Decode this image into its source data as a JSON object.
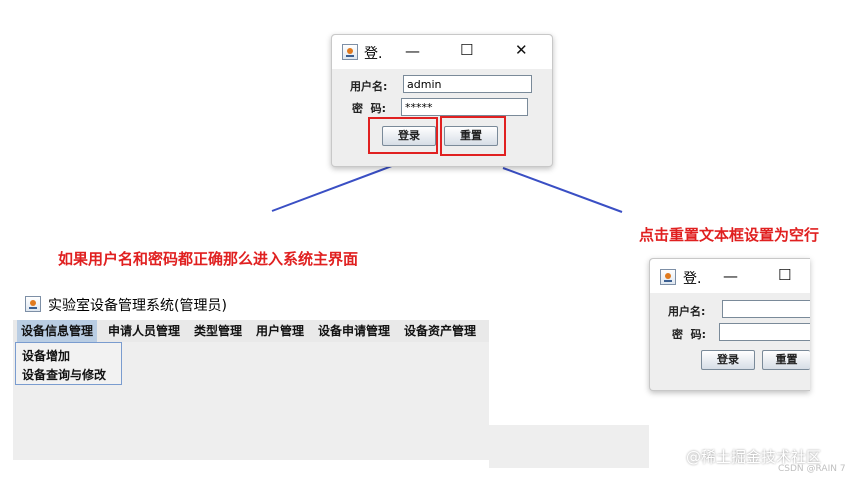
{
  "login_window_top": {
    "title": "登.",
    "minimize": "—",
    "maximize": "☐",
    "close": "✕",
    "username_label": "用户名:",
    "username_value": "admin",
    "password_label": "密  码:",
    "password_value": "*****",
    "login_button": "登录",
    "reset_button": "重置"
  },
  "annotations": {
    "success_note": "如果用户名和密码都正确那么进入系统主界面",
    "reset_note": "点击重置文本框设置为空行"
  },
  "main_window": {
    "title": "实验室设备管理系统(管理员)",
    "menus": [
      {
        "label": "设备信息管理"
      },
      {
        "label": "申请人员管理"
      },
      {
        "label": "类型管理"
      },
      {
        "label": "用户管理"
      },
      {
        "label": "设备申请管理"
      },
      {
        "label": "设备资产管理"
      }
    ],
    "dropdown_items": [
      "设备增加",
      "设备查询与修改"
    ]
  },
  "login_window_reset": {
    "title": "登.",
    "minimize": "—",
    "maximize": "☐",
    "username_label": "用户名:",
    "username_value": "",
    "password_label": "密  码:",
    "password_value": "",
    "login_button": "登录",
    "reset_button": "重置"
  },
  "watermark": {
    "line1": "@稀土掘金技术社区",
    "line2": "CSDN @RAIN 7"
  },
  "colors": {
    "annotation_red": "#e02020",
    "connector_blue": "#3a4fc4",
    "menu_highlight": "#b9cde3"
  }
}
